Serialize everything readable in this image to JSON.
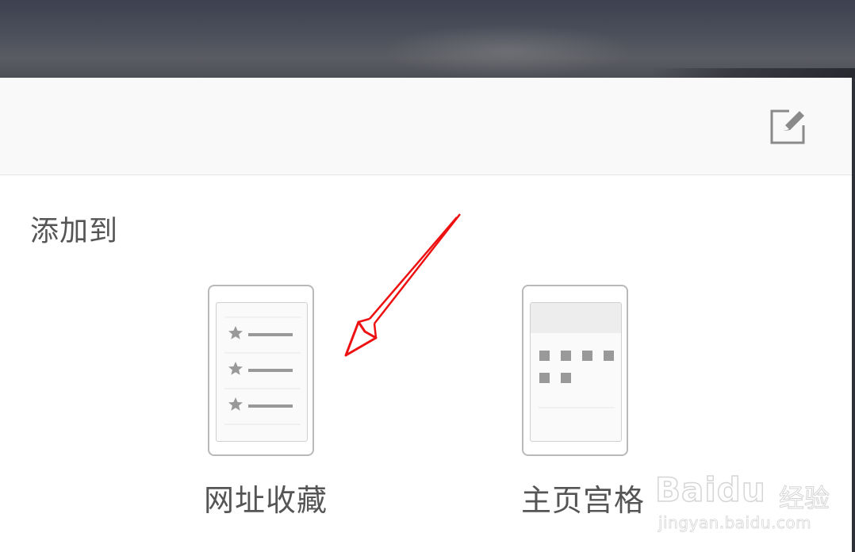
{
  "dialog": {
    "section_title": "添加到",
    "options": [
      {
        "label": "网址收藏",
        "icon": "bookmark-list-icon"
      },
      {
        "label": "主页宫格",
        "icon": "home-grid-icon"
      }
    ]
  },
  "toolbar": {
    "edit_icon": "edit-icon"
  },
  "annotation": {
    "arrow_color": "#ee1111",
    "icon": "red-arrow-annotation"
  },
  "watermark": {
    "brand": "Baidu",
    "brand_text": "经验",
    "url": "jingyan.baidu.com"
  },
  "colors": {
    "banner": "#454955",
    "toolbar_bg": "#f9f9f9",
    "text": "#555555",
    "icon_gray": "#999999"
  }
}
